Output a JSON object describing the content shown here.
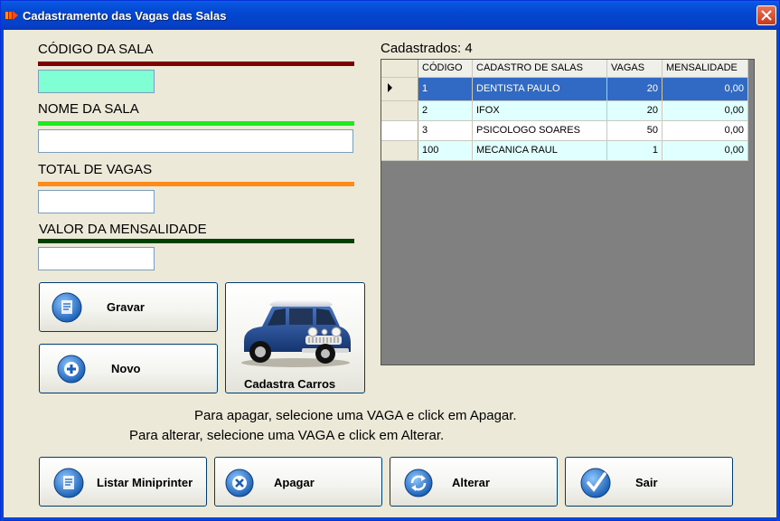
{
  "window": {
    "title": "Cadastramento das Vagas das Salas"
  },
  "form": {
    "codigo_label": "CÓDIGO DA SALA",
    "codigo_value": "",
    "nome_label": "NOME DA SALA",
    "nome_value": "",
    "vagas_label": "TOTAL DE VAGAS",
    "vagas_value": "",
    "mensalidade_label": "VALOR DA MENSALIDADE",
    "mensalidade_value": ""
  },
  "colors": {
    "codigo_bar": "#7F0000",
    "nome_bar": "#1EEB1E",
    "vagas_bar": "#FF8C1A",
    "mensalidade_bar": "#004000",
    "codigo_field": "#80FFD4"
  },
  "buttons": {
    "gravar": "Gravar",
    "novo": "Novo",
    "cadastra_carros": "Cadastra Carros",
    "listar": "Listar Miniprinter",
    "apagar": "Apagar",
    "alterar": "Alterar",
    "sair": "Sair"
  },
  "grid": {
    "counter": "Cadastrados: 4",
    "columns": [
      "CÓDIGO",
      "CADASTRO DE SALAS",
      "VAGAS",
      "MENSALIDADE"
    ],
    "rows": [
      {
        "codigo": "1",
        "sala": "DENTISTA PAULO",
        "vagas": "20",
        "mensalidade": "0,00"
      },
      {
        "codigo": "2",
        "sala": "IFOX",
        "vagas": "20",
        "mensalidade": "0,00"
      },
      {
        "codigo": "3",
        "sala": "PSICOLOGO SOARES",
        "vagas": "50",
        "mensalidade": "0,00"
      },
      {
        "codigo": "100",
        "sala": "MECANICA RAUL",
        "vagas": "1",
        "mensalidade": "0,00"
      }
    ]
  },
  "info": {
    "apagar": "Para apagar, selecione uma VAGA e click em Apagar.",
    "alterar": "Para alterar, selecione uma VAGA e click em Alterar."
  }
}
